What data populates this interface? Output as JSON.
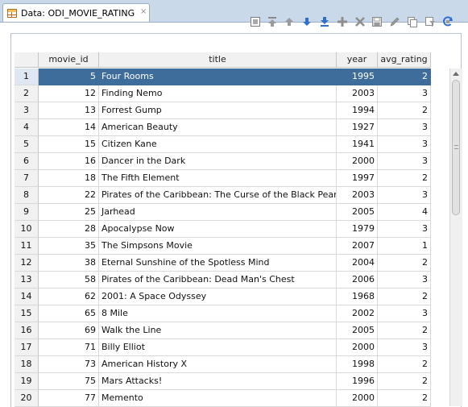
{
  "tab": {
    "label": "Data: ODI_MOVIE_RATING",
    "close": "×"
  },
  "toolbar": {
    "buttons": [
      "freeze-view-icon",
      "first-row-icon",
      "previous-row-icon",
      "next-row-icon",
      "last-row-icon",
      "insert-row-icon",
      "delete-row-icon",
      "commit-icon",
      "edit-icon",
      "copy-icon",
      "filter-icon",
      "refresh-icon"
    ]
  },
  "columns": [
    "movie_id",
    "title",
    "year",
    "avg_rating"
  ],
  "rows": [
    [
      "1",
      "5",
      "Four Rooms",
      "1995",
      "2"
    ],
    [
      "2",
      "12",
      "Finding Nemo",
      "2003",
      "3"
    ],
    [
      "3",
      "13",
      "Forrest Gump",
      "1994",
      "2"
    ],
    [
      "4",
      "14",
      "American Beauty",
      "1927",
      "3"
    ],
    [
      "5",
      "15",
      "Citizen Kane",
      "1941",
      "3"
    ],
    [
      "6",
      "16",
      "Dancer in the Dark",
      "2000",
      "3"
    ],
    [
      "7",
      "18",
      "The Fifth Element",
      "1997",
      "2"
    ],
    [
      "8",
      "22",
      "Pirates of the Caribbean: The Curse of the Black Pearl",
      "2003",
      "3"
    ],
    [
      "9",
      "25",
      "Jarhead",
      "2005",
      "4"
    ],
    [
      "10",
      "28",
      "Apocalypse Now",
      "1979",
      "3"
    ],
    [
      "11",
      "35",
      "The Simpsons Movie",
      "2007",
      "1"
    ],
    [
      "12",
      "38",
      "Eternal Sunshine of the Spotless Mind",
      "2004",
      "2"
    ],
    [
      "13",
      "58",
      "Pirates of the Caribbean: Dead Man's Chest",
      "2006",
      "3"
    ],
    [
      "14",
      "62",
      "2001: A Space Odyssey",
      "1968",
      "2"
    ],
    [
      "15",
      "65",
      "8 Mile",
      "2002",
      "3"
    ],
    [
      "16",
      "69",
      "Walk the Line",
      "2005",
      "2"
    ],
    [
      "17",
      "71",
      "Billy Elliot",
      "2000",
      "3"
    ],
    [
      "18",
      "73",
      "American History X",
      "1998",
      "2"
    ],
    [
      "19",
      "75",
      "Mars Attacks!",
      "1996",
      "2"
    ],
    [
      "20",
      "77",
      "Memento",
      "2000",
      "2"
    ]
  ],
  "selected_row": 1,
  "colors": {
    "selection": "#3e6d9c",
    "tab_bg": "#c9d9ea",
    "accent_blue": "#2f6fd0"
  }
}
